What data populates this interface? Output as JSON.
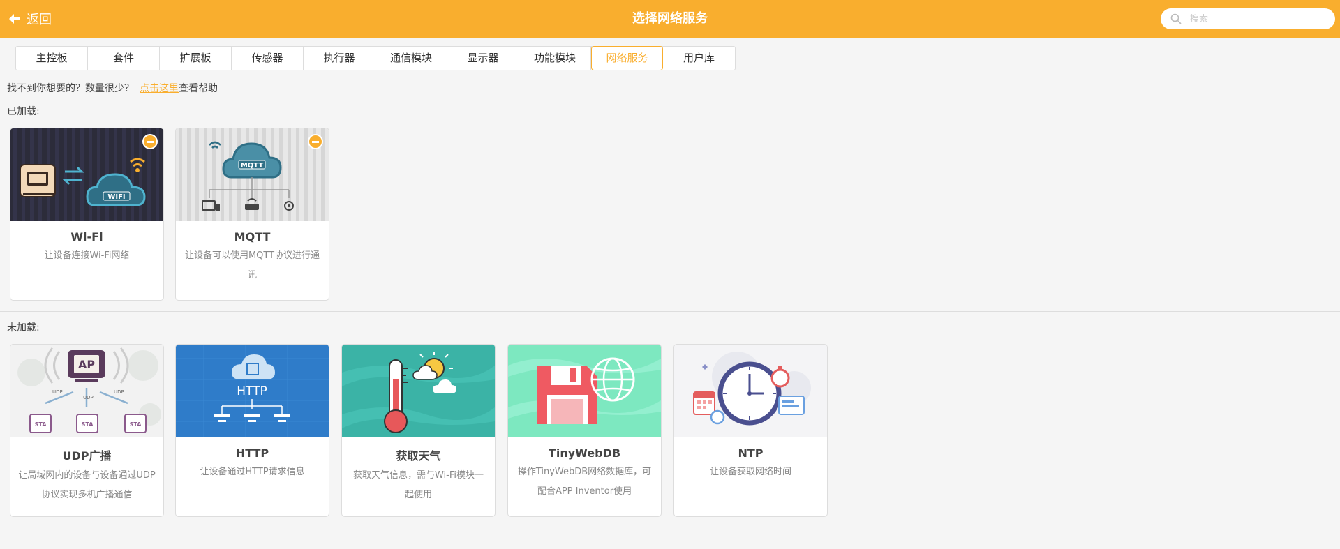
{
  "header": {
    "back_label": "返回",
    "title": "选择网络服务",
    "search_placeholder": "搜索",
    "accent_color": "#f9ae2e"
  },
  "tabs": [
    {
      "label": "主控板",
      "active": false
    },
    {
      "label": "套件",
      "active": false
    },
    {
      "label": "扩展板",
      "active": false
    },
    {
      "label": "传感器",
      "active": false
    },
    {
      "label": "执行器",
      "active": false
    },
    {
      "label": "通信模块",
      "active": false
    },
    {
      "label": "显示器",
      "active": false
    },
    {
      "label": "功能模块",
      "active": false
    },
    {
      "label": "网络服务",
      "active": true
    },
    {
      "label": "用户库",
      "active": false
    }
  ],
  "help": {
    "prefix": "找不到你想要的？数量很少？",
    "link": "点击这里",
    "suffix": "查看帮助"
  },
  "loaded": {
    "label": "已加载:",
    "items": [
      {
        "name": "Wi-Fi",
        "desc": "让设备连接Wi-Fi网络",
        "icon": "wifi-cloud-icon"
      },
      {
        "name": "MQTT",
        "desc": "让设备可以使用MQTT协议进行通讯",
        "icon": "mqtt-cloud-icon"
      }
    ]
  },
  "unloaded": {
    "label": "未加载:",
    "items": [
      {
        "name": "UDP广播",
        "desc": "让局域网内的设备与设备通过UDP协议实现多机广播通信",
        "icon": "udp-broadcast-icon"
      },
      {
        "name": "HTTP",
        "desc": "让设备通过HTTP请求信息",
        "icon": "http-cloud-icon"
      },
      {
        "name": "获取天气",
        "desc": "获取天气信息，需与Wi-Fi模块一起使用",
        "icon": "weather-thermometer-icon"
      },
      {
        "name": "TinyWebDB",
        "desc": "操作TinyWebDB网络数据库，可配合APP Inventor使用",
        "icon": "tinywebdb-floppy-icon"
      },
      {
        "name": "NTP",
        "desc": "让设备获取网络时间",
        "icon": "ntp-clock-icon"
      }
    ]
  },
  "image_text": {
    "wifi": "WIFI",
    "mqtt": "MQTT",
    "ap": "AP",
    "udp": "UDP",
    "sta": "STA",
    "http": "HTTP"
  }
}
